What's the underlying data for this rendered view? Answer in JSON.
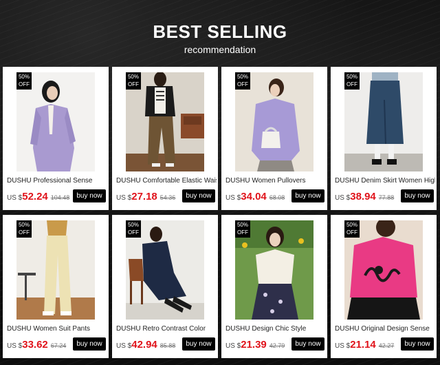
{
  "header": {
    "title": "BEST SELLING",
    "subtitle": "recommendation"
  },
  "products": [
    {
      "name": "DUSHU Professional Sense",
      "currency": "US $",
      "price": "52.24",
      "old_price": "104.48",
      "badge_pct": "50%",
      "badge_off": "OFF",
      "button": "buy now"
    },
    {
      "name": "DUSHU Comfortable Elastic Waist",
      "currency": "US $",
      "price": "27.18",
      "old_price": "54.36",
      "badge_pct": "50%",
      "badge_off": "OFF",
      "button": "buy now"
    },
    {
      "name": "DUSHU Women Pullovers",
      "currency": "US $",
      "price": "34.04",
      "old_price": "68.08",
      "badge_pct": "50%",
      "badge_off": "OFF",
      "button": "buy now"
    },
    {
      "name": "DUSHU Denim Skirt Women High",
      "currency": "US $",
      "price": "38.94",
      "old_price": "77.88",
      "badge_pct": "50%",
      "badge_off": "OFF",
      "button": "buy now"
    },
    {
      "name": "DUSHU Women Suit Pants",
      "currency": "US $",
      "price": "33.62",
      "old_price": "67.24",
      "badge_pct": "50%",
      "badge_off": "OFF",
      "button": "buy now"
    },
    {
      "name": "DUSHU Retro Contrast Color",
      "currency": "US $",
      "price": "42.94",
      "old_price": "85.88",
      "badge_pct": "50%",
      "badge_off": "OFF",
      "button": "buy now"
    },
    {
      "name": "DUSHU Design Chic Style",
      "currency": "US $",
      "price": "21.39",
      "old_price": "42.79",
      "badge_pct": "50%",
      "badge_off": "OFF",
      "button": "buy now"
    },
    {
      "name": "DUSHU Original Design Sense",
      "currency": "US $",
      "price": "21.14",
      "old_price": "42.27",
      "badge_pct": "50%",
      "badge_off": "OFF",
      "button": "buy now"
    }
  ],
  "colors": {
    "sale_price": "#e0131b",
    "button_bg": "#000000",
    "background": "#0e0e0e"
  }
}
